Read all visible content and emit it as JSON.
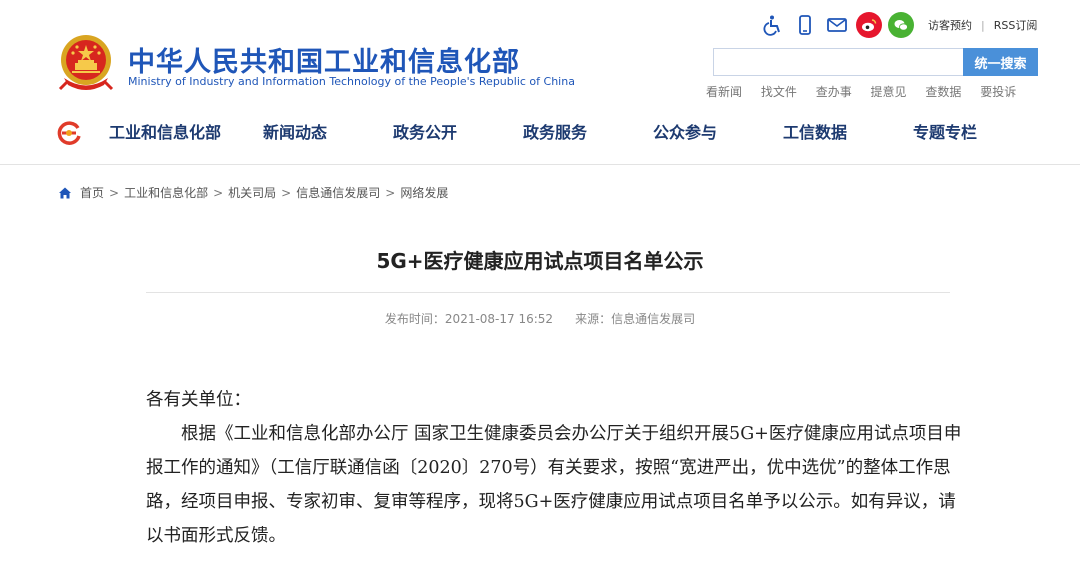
{
  "header": {
    "site_title": "中华人民共和国工业和信息化部",
    "site_subtitle": "Ministry of Industry and Information Technology of the People's Republic of China",
    "utility_links": [
      "访客预约",
      "RSS订阅"
    ],
    "search": {
      "placeholder": "",
      "button_label": "统一搜索"
    },
    "quick_links": [
      "看新闻",
      "找文件",
      "查办事",
      "提意见",
      "查数据",
      "要投诉"
    ]
  },
  "nav": {
    "items": [
      "工业和信息化部",
      "新闻动态",
      "政务公开",
      "政务服务",
      "公众参与",
      "工信数据",
      "专题专栏"
    ]
  },
  "breadcrumb": {
    "items": [
      "首页",
      "工业和信息化部",
      "机关司局",
      "信息通信发展司",
      "网络发展"
    ],
    "separator": ">"
  },
  "article": {
    "title": "5G+医疗健康应用试点项目名单公示",
    "publish_time_label": "发布时间：2021-08-17 16:52",
    "source_label": "来源：信息通信发展司",
    "salutation": "各有关单位：",
    "paragraph": "根据《工业和信息化部办公厅 国家卫生健康委员会办公厅关于组织开展5G+医疗健康应用试点项目申报工作的通知》（工信厅联通信函〔2020〕270号）有关要求，按照“宽进严出，优中选优”的整体工作思路，经项目申报、专家初审、复审等程序，现将5G+医疗健康应用试点项目名单予以公示。如有异议，请以书面形式反馈。"
  },
  "colors": {
    "brand_blue": "#1f56b8",
    "nav_text": "#1d3a70",
    "search_button": "#4a90d9",
    "weibo_red": "#e6162d",
    "wechat_green": "#49b233"
  }
}
